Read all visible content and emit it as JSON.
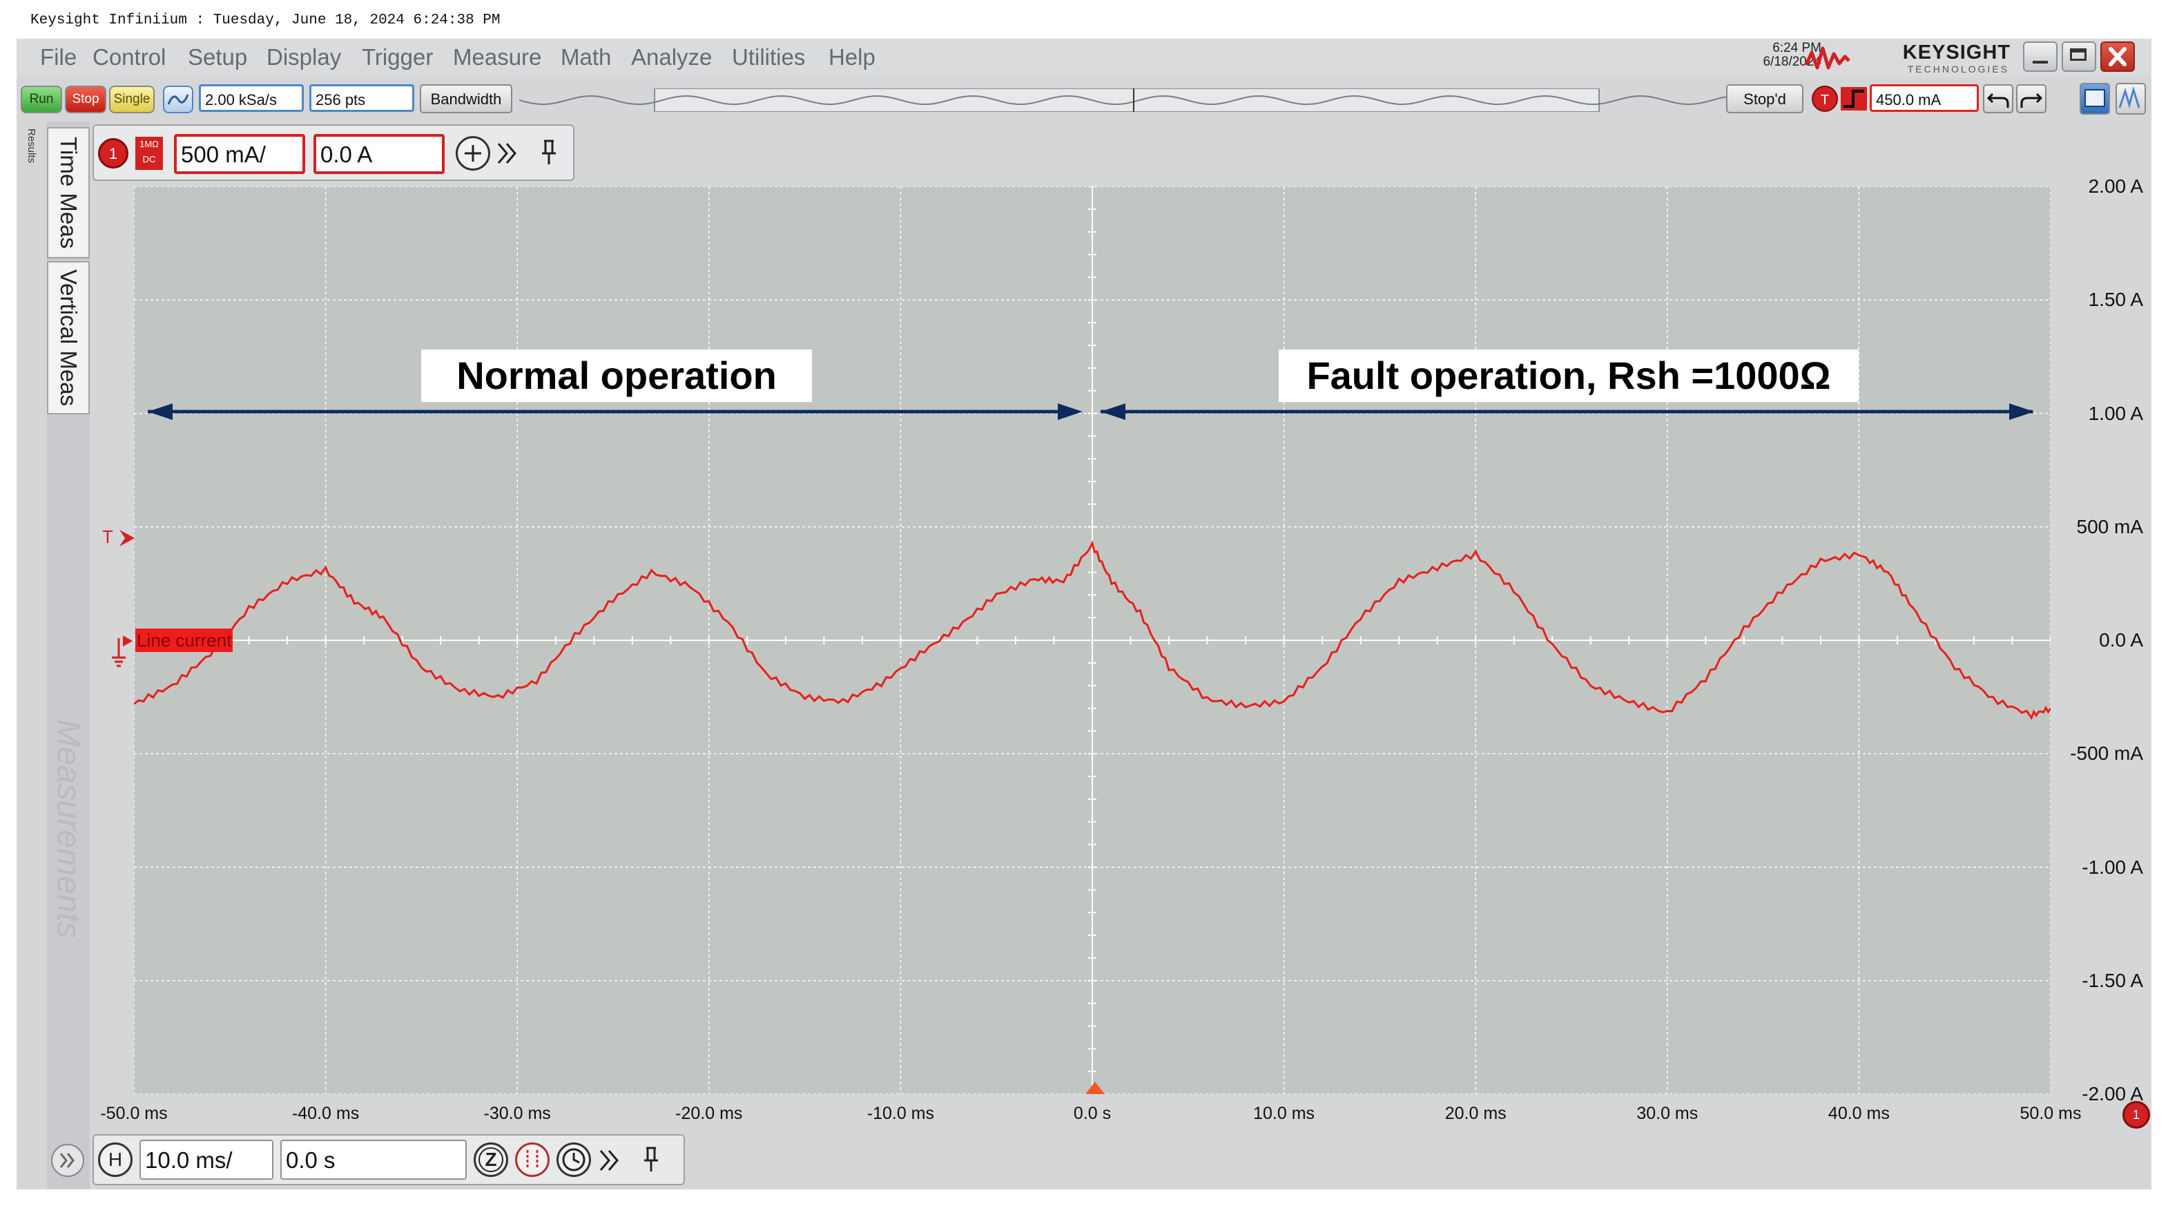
{
  "window": {
    "title": "Keysight Infiniium : Tuesday, June 18, 2024 6:24:38 PM",
    "time": "6:24 PM",
    "date": "6/18/2024",
    "brand": "KEYSIGHT",
    "brand_sub": "TECHNOLOGIES"
  },
  "menu": [
    "File",
    "Control",
    "Setup",
    "Display",
    "Trigger",
    "Measure",
    "Math",
    "Analyze",
    "Utilities",
    "Help"
  ],
  "toolbar": {
    "run": "Run",
    "stop": "Stop",
    "single": "Single",
    "sample_rate": "2.00 kSa/s",
    "points": "256 pts",
    "bandwidth": "Bandwidth",
    "status": "Stop'd",
    "trigger_badge": "T",
    "trigger_level": "450.0 mA"
  },
  "sidebar": {
    "results_label": "Results",
    "tabs": [
      "Time Meas",
      "Vertical Meas"
    ],
    "faded_label": "Measurements"
  },
  "channel": {
    "number": "1",
    "coupling_top": "1MΩ",
    "coupling_bottom": "DC",
    "scale": "500 mA/",
    "offset": "0.0 A"
  },
  "plot": {
    "trigger_marker": "T",
    "trace_label": "Line current",
    "annotations": {
      "left": "Normal operation",
      "right": "Fault operation, Rsh =1000Ω"
    },
    "channel_marker": "1"
  },
  "horizontal": {
    "label": "H",
    "scale": "10.0 ms/",
    "position": "0.0 s",
    "zoom": "Z"
  },
  "chart_data": {
    "type": "line",
    "title": "",
    "xlabel": "",
    "ylabel": "",
    "xlim": [
      -50,
      50
    ],
    "ylim": [
      -2.0,
      2.0
    ],
    "x_units": "ms",
    "y_units": "A",
    "xticks": [
      "-50.0 ms",
      "-40.0 ms",
      "-30.0 ms",
      "-20.0 ms",
      "-10.0 ms",
      "0.0 s",
      "10.0 ms",
      "20.0 ms",
      "30.0 ms",
      "40.0 ms",
      "50.0 ms"
    ],
    "yticks": [
      {
        "value": 2.0,
        "label": "2.00 A"
      },
      {
        "value": 1.5,
        "label": "1.50 A"
      },
      {
        "value": 1.0,
        "label": "1.00 A"
      },
      {
        "value": 0.5,
        "label": "500 mA"
      },
      {
        "value": 0.0,
        "label": "0.0 A"
      },
      {
        "value": -0.5,
        "label": "-500 mA"
      },
      {
        "value": -1.0,
        "label": "-1.00 A"
      },
      {
        "value": -1.5,
        "label": "-1.50 A"
      },
      {
        "value": -2.0,
        "label": "-2.00 A"
      }
    ],
    "grid": true,
    "series": [
      {
        "name": "Line current",
        "color": "#e8201c",
        "x": [
          -50,
          -48,
          -46,
          -44,
          -42,
          -40,
          -38.5,
          -37,
          -35,
          -33,
          -31,
          -29,
          -27,
          -25,
          -23,
          -21,
          -19,
          -17,
          -15,
          -13,
          -11,
          -9,
          -7,
          -5,
          -3,
          -1.5,
          0,
          1,
          2.5,
          4,
          6,
          8,
          10,
          12,
          14,
          16,
          18,
          20,
          22,
          24,
          26,
          28,
          30,
          32,
          34,
          36,
          38,
          40,
          41.5,
          43,
          45,
          47,
          49,
          50
        ],
        "y": [
          -0.28,
          -0.2,
          -0.06,
          0.14,
          0.26,
          0.31,
          0.17,
          0.1,
          -0.12,
          -0.22,
          -0.25,
          -0.18,
          0.02,
          0.18,
          0.3,
          0.24,
          0.08,
          -0.15,
          -0.25,
          -0.27,
          -0.19,
          -0.06,
          0.06,
          0.2,
          0.27,
          0.26,
          0.42,
          0.26,
          0.12,
          -0.12,
          -0.26,
          -0.29,
          -0.27,
          -0.12,
          0.1,
          0.26,
          0.32,
          0.38,
          0.22,
          -0.02,
          -0.2,
          -0.27,
          -0.32,
          -0.17,
          0.05,
          0.22,
          0.35,
          0.38,
          0.3,
          0.12,
          -0.12,
          -0.26,
          -0.33,
          -0.3
        ]
      }
    ]
  }
}
